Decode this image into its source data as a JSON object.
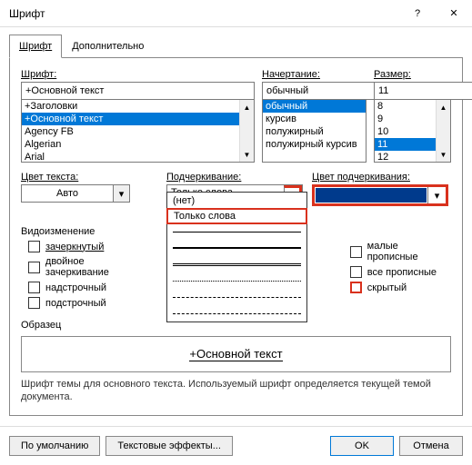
{
  "window": {
    "title": "Шрифт",
    "help": "?",
    "close": "✕"
  },
  "tabs": {
    "font": "Шрифт",
    "advanced": "Дополнительно"
  },
  "font": {
    "label": "Шрифт:",
    "value": "+Основной текст",
    "items": [
      "+Заголовки",
      "+Основной текст",
      "Agency FB",
      "Algerian",
      "Arial"
    ]
  },
  "style": {
    "label": "Начертание:",
    "value": "обычный",
    "items": [
      "обычный",
      "курсив",
      "полужирный",
      "полужирный курсив"
    ]
  },
  "size": {
    "label": "Размер:",
    "value": "11",
    "items": [
      "8",
      "9",
      "10",
      "11",
      "12"
    ]
  },
  "textcolor": {
    "label": "Цвет текста:",
    "value": "Авто"
  },
  "underline": {
    "label": "Подчеркивание:",
    "value": "Только слова",
    "opt_none": "(нет)",
    "opt_words": "Только слова"
  },
  "ucolor": {
    "label": "Цвет подчеркивания:"
  },
  "effects": {
    "label": "Видоизменение",
    "strike": "зачеркнутый",
    "dstrike": "двойное зачеркивание",
    "super": "надстрочный",
    "sub": "подстрочный",
    "smallcaps": "малые прописные",
    "allcaps": "все прописные",
    "hidden": "скрытый"
  },
  "preview": {
    "label": "Образец",
    "sample": "+Основной текст"
  },
  "hint": "Шрифт темы для основного текста. Используемый шрифт определяется текущей темой документа.",
  "buttons": {
    "default": "По умолчанию",
    "texteff": "Текстовые эффекты...",
    "ok": "OK",
    "cancel": "Отмена"
  }
}
